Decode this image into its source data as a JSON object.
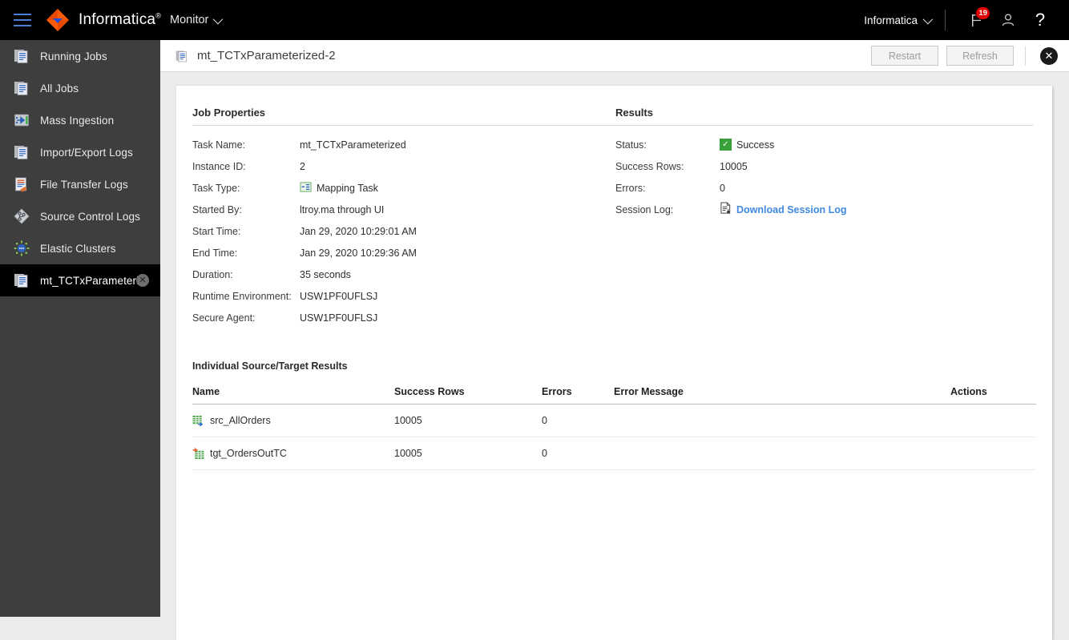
{
  "topbar": {
    "menu_icon": "hamburger-icon",
    "logo_icon": "informatica-logo-icon",
    "brand": "Informatica",
    "brand_tm": "®",
    "module": "Monitor",
    "org": "Informatica",
    "flag_icon": "flag-icon",
    "notification_count": "19",
    "user_icon": "user-icon",
    "help_icon": "help-icon",
    "help_glyph": "?"
  },
  "sidebar": {
    "items": [
      {
        "label": "Running Jobs",
        "icon": "jobs-document-icon",
        "active": false
      },
      {
        "label": "All Jobs",
        "icon": "jobs-document-icon",
        "active": false
      },
      {
        "label": "Mass Ingestion",
        "icon": "mass-ingestion-icon",
        "active": false
      },
      {
        "label": "Import/Export Logs",
        "icon": "jobs-document-icon",
        "active": false
      },
      {
        "label": "File Transfer Logs",
        "icon": "file-transfer-icon",
        "active": false
      },
      {
        "label": "Source Control Logs",
        "icon": "source-control-icon",
        "active": false
      },
      {
        "label": "Elastic Clusters",
        "icon": "elastic-clusters-icon",
        "active": false
      },
      {
        "label": "mt_TCTxParameteri...",
        "icon": "jobs-document-icon",
        "active": true,
        "closable": true,
        "close_glyph": "✕"
      }
    ]
  },
  "page_header": {
    "icon": "job-detail-icon",
    "title": "mt_TCTxParameterized-2",
    "restart_label": "Restart",
    "refresh_label": "Refresh",
    "close_glyph": "✕",
    "close_name": "close-panel-button"
  },
  "job_properties": {
    "title": "Job Properties",
    "rows": [
      {
        "label": "Task Name:",
        "value": "mt_TCTxParameterized"
      },
      {
        "label": "Instance ID:",
        "value": "2"
      },
      {
        "label": "Task Type:",
        "value": "Mapping Task",
        "icon": "mapping-task-icon"
      },
      {
        "label": "Started By:",
        "value": "ltroy.ma through UI"
      },
      {
        "label": "Start Time:",
        "value": "Jan 29, 2020 10:29:01 AM"
      },
      {
        "label": "End Time:",
        "value": "Jan 29, 2020 10:29:36 AM"
      },
      {
        "label": "Duration:",
        "value": "35 seconds"
      },
      {
        "label": "Runtime Environment:",
        "value": "USW1PF0UFLSJ"
      },
      {
        "label": "Secure Agent:",
        "value": "USW1PF0UFLSJ"
      }
    ]
  },
  "results": {
    "title": "Results",
    "status_label": "Status:",
    "status_value": "Success",
    "status_icon": "success-check-icon",
    "status_color": "#3aa13a",
    "success_rows_label": "Success Rows:",
    "success_rows_value": "10005",
    "errors_label": "Errors:",
    "errors_value": "0",
    "session_log_label": "Session Log:",
    "session_log_link": "Download Session Log",
    "session_log_icon": "download-log-icon",
    "link_color": "#3f8ae0"
  },
  "individual_results": {
    "title": "Individual Source/Target Results",
    "columns": [
      "Name",
      "Success Rows",
      "Errors",
      "Error Message",
      "Actions"
    ],
    "rows": [
      {
        "name": "src_AllOrders",
        "icon": "source-table-icon",
        "success_rows": "10005",
        "errors": "0",
        "error_message": "",
        "actions": ""
      },
      {
        "name": "tgt_OrdersOutTC",
        "icon": "target-table-icon",
        "success_rows": "10005",
        "errors": "0",
        "error_message": "",
        "actions": ""
      }
    ]
  }
}
